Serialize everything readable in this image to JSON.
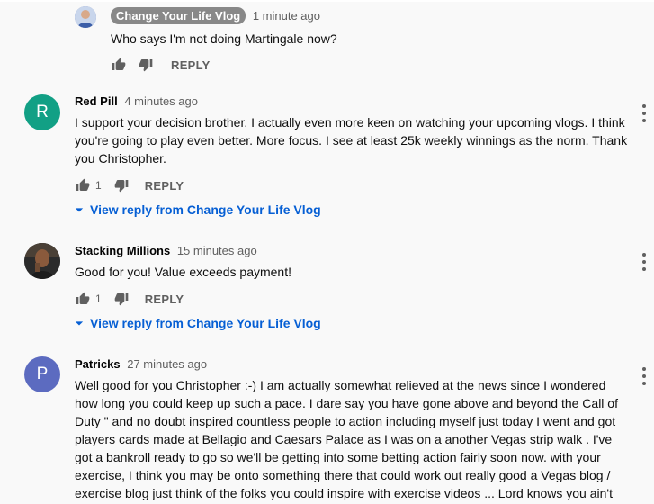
{
  "reply": {
    "author": "Change Your Life Vlog",
    "time": "1 minute ago",
    "text": "Who says I'm not doing Martingale now?",
    "reply_label": "REPLY",
    "avatar_color": "#6a7fb5"
  },
  "comments": [
    {
      "author": "Red Pill",
      "time": "4 minutes ago",
      "avatar_letter": "R",
      "avatar_color": "#12a085",
      "text": "I support your decision brother. I actually even more keen on watching your upcoming vlogs. I think you're going to play even better. More focus. I see at least 25k weekly winnings as the norm. Thank you Christopher.",
      "likes": "1",
      "reply_label": "REPLY",
      "view_reply": "View reply from Change Your Life Vlog"
    },
    {
      "author": "Stacking Millions",
      "time": "15 minutes ago",
      "avatar_color": "#3a3a3a",
      "text": "Good for you! Value exceeds payment!",
      "likes": "1",
      "reply_label": "REPLY",
      "view_reply": "View reply from Change Your Life Vlog"
    },
    {
      "author": "Patricks",
      "time": "27 minutes ago",
      "avatar_letter": "P",
      "avatar_color": "#5c6bc0",
      "text": "Well good for you Christopher :-) I am actually somewhat relieved at the news since I wondered how long you could keep up such a pace. I dare say you have gone above and beyond the Call of Duty \" and no doubt inspired countless people to action including myself just today I went and got players cards made at Bellagio and Caesars Palace as I was on a another Vegas strip walk . I've got a bankroll ready to go so we'll be getting into some betting action fairly soon now. with your exercise, I think you may be onto something there that could work out really good a Vegas blog / exercise blog just think of the folks you could inspire with exercise videos ... Lord knows you ain't"
    }
  ]
}
